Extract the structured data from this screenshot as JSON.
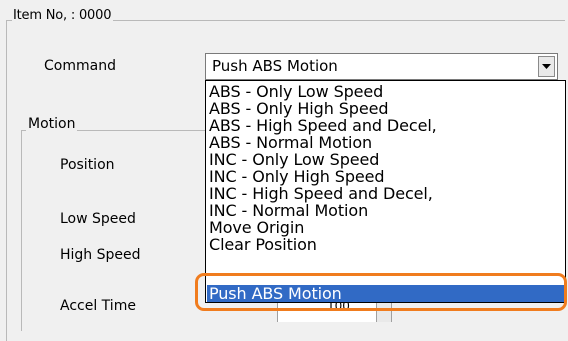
{
  "item_group": {
    "title": "Item No, : 0000"
  },
  "command": {
    "label": "Command",
    "selected": "Push ABS Motion",
    "options": [
      "ABS - Only Low Speed",
      "ABS - Only High Speed",
      "ABS - High Speed and Decel,",
      "ABS - Normal Motion",
      "INC - Only Low Speed",
      "INC - Only High Speed",
      "INC - High Speed and Decel,",
      "INC - Normal Motion",
      "Move Origin",
      "Clear Position",
      "Push ABS Motion"
    ]
  },
  "motion_group": {
    "title": "Motion",
    "labels": {
      "position": "Position",
      "low_speed": "Low Speed",
      "high_speed": "High Speed",
      "accel_time": "Accel Time"
    },
    "accel_time_value": "100"
  },
  "colors": {
    "selection": "#316ac5",
    "highlight": "#f07c1e",
    "background": "#f0f0f0"
  }
}
